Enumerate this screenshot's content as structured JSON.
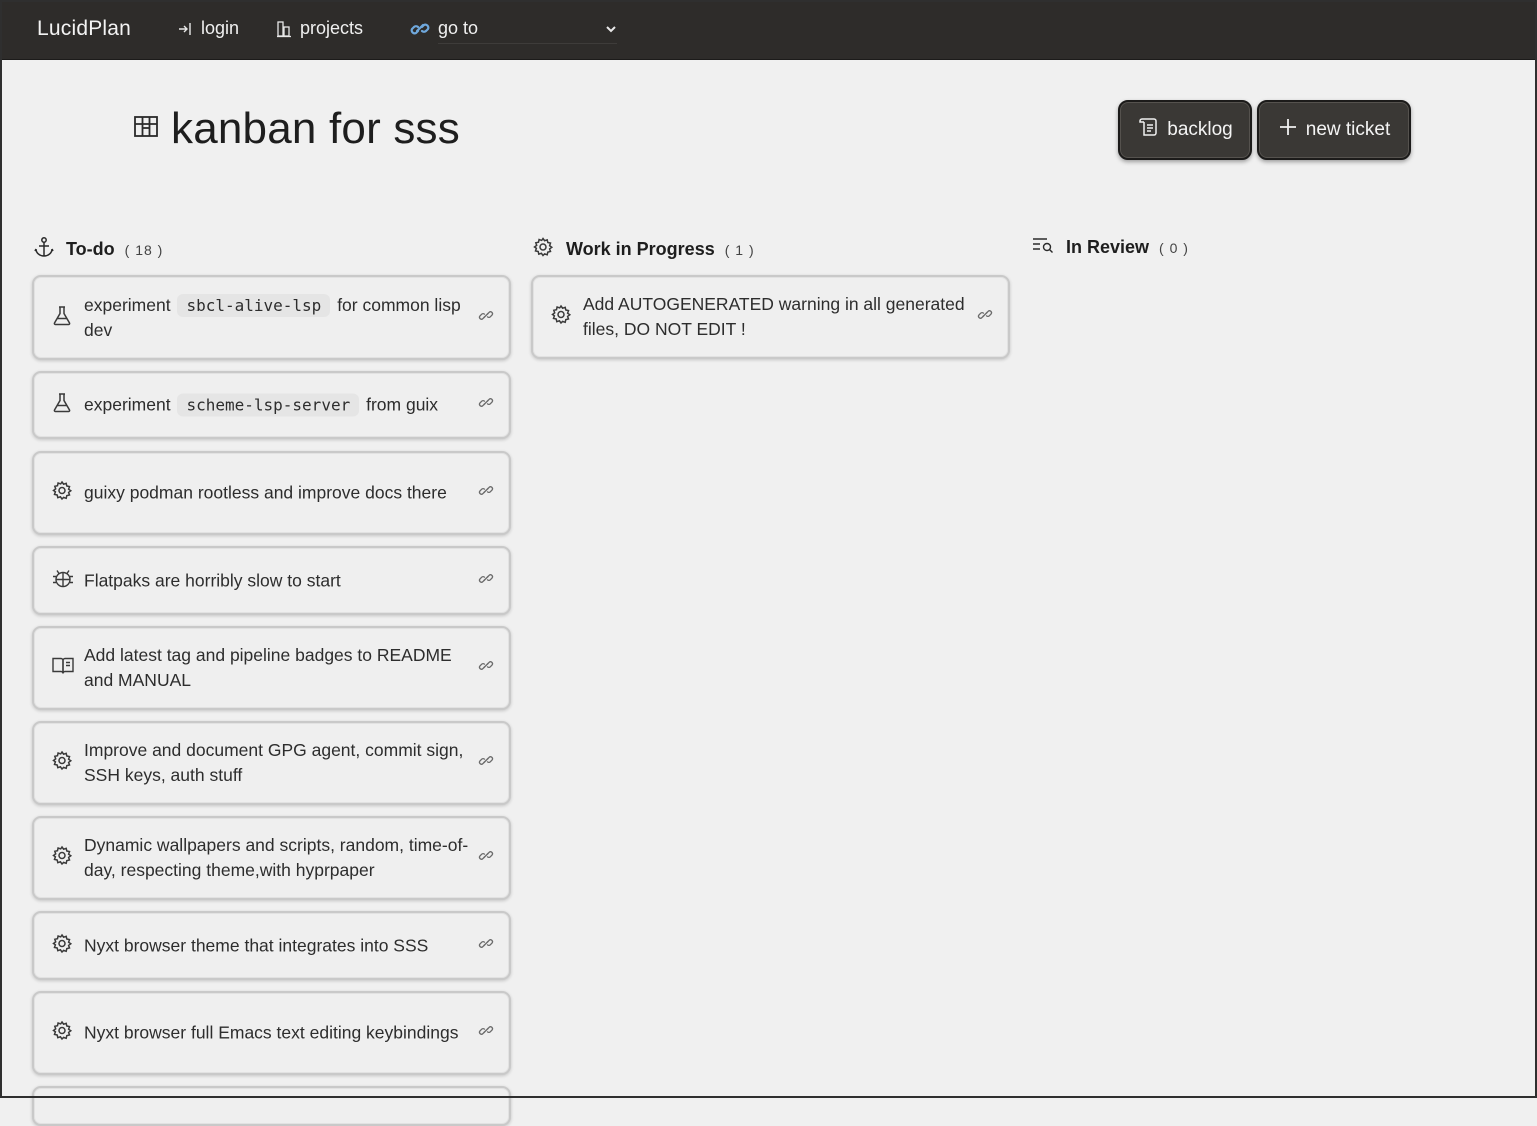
{
  "nav": {
    "brand": "LucidPlan",
    "login": "login",
    "projects": "projects",
    "goto": "go to"
  },
  "header": {
    "title": "kanban for sss",
    "backlog_label": "backlog",
    "new_ticket_label": "new ticket"
  },
  "columns": {
    "todo": {
      "title": "To-do",
      "count": "( 18 )"
    },
    "wip": {
      "title": "Work in Progress",
      "count": "( 1 )"
    },
    "review": {
      "title": "In Review",
      "count": "( 0 )"
    }
  },
  "todo_cards": [
    {
      "icon": "flask-icon",
      "pre": "experiment",
      "code": "sbcl-alive-lsp",
      "post": "for common lisp dev"
    },
    {
      "icon": "flask-icon",
      "pre": "experiment",
      "code": "scheme-lsp-server",
      "post": "from guix"
    },
    {
      "icon": "gear-icon",
      "text": "guixy podman rootless and improve docs there"
    },
    {
      "icon": "bug-icon",
      "text": "Flatpaks are horribly slow to start"
    },
    {
      "icon": "book-icon",
      "text": "Add latest tag and pipeline badges to README and MANUAL"
    },
    {
      "icon": "gear-icon",
      "text": "Improve and document GPG agent, commit sign, SSH keys, auth stuff"
    },
    {
      "icon": "gear-icon",
      "text": "Dynamic wallpapers and scripts, random, time-of-day, respecting theme,with hyprpaper"
    },
    {
      "icon": "gear-icon",
      "text": "Nyxt browser theme that integrates into SSS"
    },
    {
      "icon": "gear-icon",
      "text": "Nyxt browser full Emacs text editing keybindings"
    }
  ],
  "wip_cards": [
    {
      "icon": "gear-icon",
      "text": "Add AUTOGENERATED warning in all generated files, DO NOT EDIT !"
    }
  ]
}
